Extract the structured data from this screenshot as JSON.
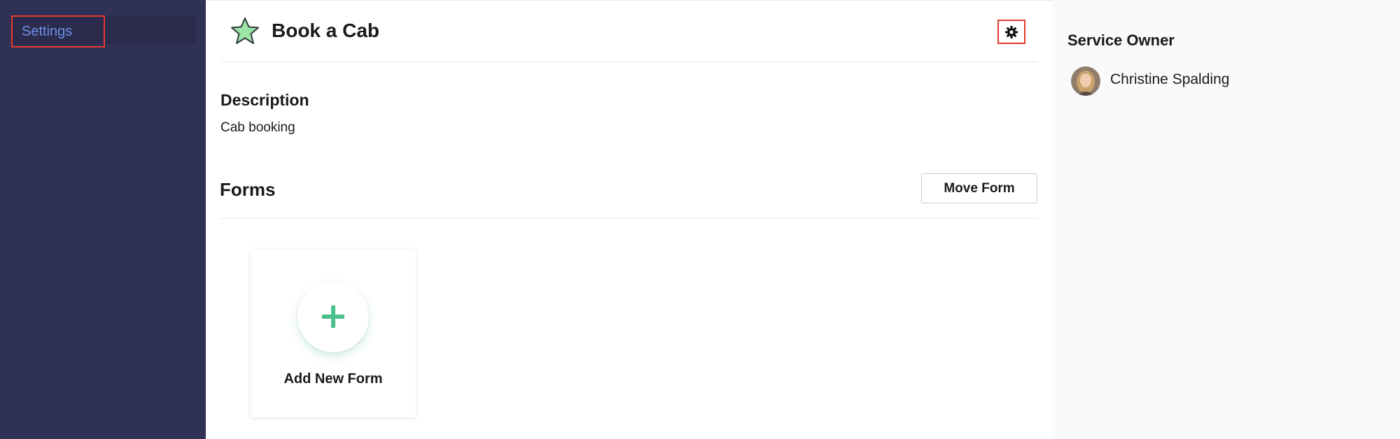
{
  "sidebar": {
    "items": [
      {
        "label": "Settings"
      }
    ]
  },
  "header": {
    "title": "Book a Cab",
    "star_icon": "star-icon",
    "settings_icon": "gear-icon"
  },
  "description": {
    "heading": "Description",
    "text": "Cab booking"
  },
  "forms": {
    "heading": "Forms",
    "move_label": "Move Form",
    "add_label": "Add New Form",
    "add_icon": "plus-icon"
  },
  "owner": {
    "heading": "Service Owner",
    "name": "Christine Spalding"
  },
  "colors": {
    "sidebar_bg": "#303157",
    "sidebar_link": "#6f8fe6",
    "accent_green": "#4cbf8a",
    "highlight_red": "#e53b2c"
  }
}
